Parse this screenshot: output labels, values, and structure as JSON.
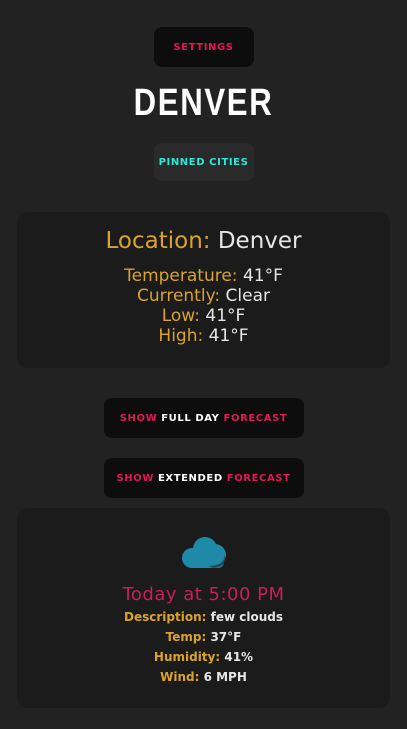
{
  "header": {
    "settings_label": "SETTINGS",
    "city_title": "DENVER",
    "pinned_label": "PINNED CITIES"
  },
  "current": {
    "location_label": "Location:",
    "location_value": "Denver",
    "temperature_label": "Temperature:",
    "temperature_value": "41°F",
    "currently_label": "Currently:",
    "currently_value": "Clear",
    "low_label": "Low:",
    "low_value": "41°F",
    "high_label": "High:",
    "high_value": "41°F"
  },
  "forecast_buttons": {
    "full_day": {
      "show": "SHOW",
      "middle": "FULL DAY",
      "end": "FORECAST"
    },
    "extended": {
      "show": "SHOW",
      "middle": "EXTENDED",
      "end": "FORECAST"
    }
  },
  "forecast_card": {
    "icon": "cloud-icon",
    "time_heading": "Today at 5:00 PM",
    "description_label": "Description:",
    "description_value": "few clouds",
    "temp_label": "Temp:",
    "temp_value": "37°F",
    "humidity_label": "Humidity:",
    "humidity_value": "41%",
    "wind_label": "Wind:",
    "wind_value": "6 MPH"
  },
  "colors": {
    "background": "#222222",
    "accent_red": "#e0194f",
    "accent_cyan": "#2ee8d9",
    "label_gold": "#d9a32e",
    "icon_teal": "#1f8aa8"
  }
}
